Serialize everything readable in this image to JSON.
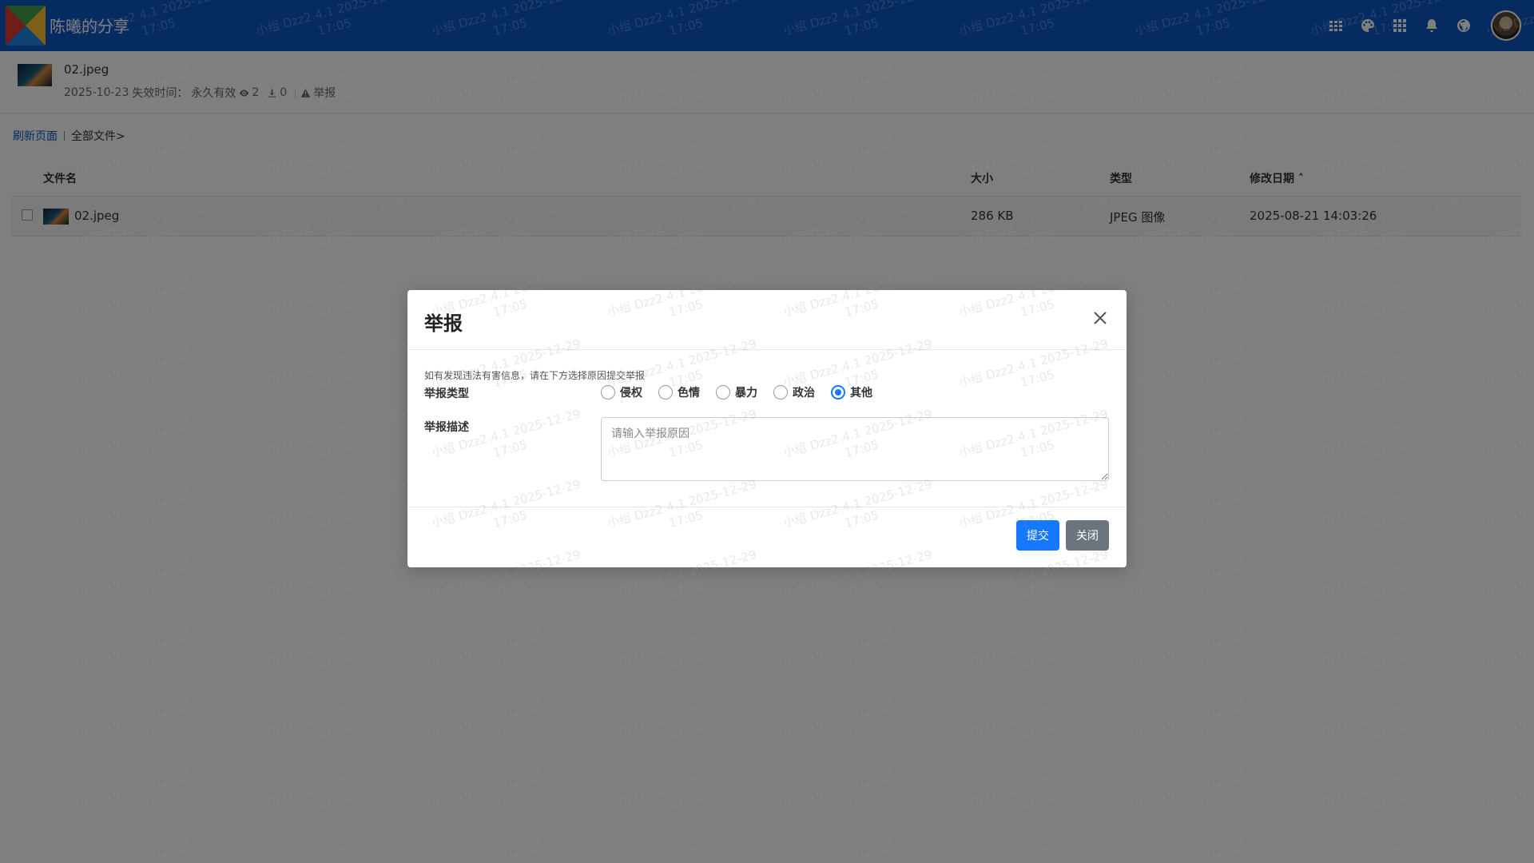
{
  "header": {
    "site_title": "陈曦的分享",
    "icons": [
      "grid-icon",
      "palette-icon",
      "apps-icon",
      "bell-icon",
      "globe-icon"
    ],
    "accent_color": "#0a56c2"
  },
  "file": {
    "name": "02.jpeg",
    "date": "2025-10-23",
    "expire_label": "失效时间：",
    "expire_value": "永久有效",
    "views": "2",
    "downloads": "0",
    "report_label": "举报"
  },
  "breadcrumb": {
    "refresh": "刷新页面",
    "all_files": "全部文件>"
  },
  "table": {
    "headers": {
      "name": "文件名",
      "size": "大小",
      "type": "类型",
      "modified": "修改日期 ˄"
    },
    "rows": [
      {
        "name": "02.jpeg",
        "size": "286 KB",
        "type": "JPEG 图像",
        "modified": "2025-08-21 14:03:26"
      }
    ]
  },
  "watermark": {
    "line1": "小组 Dzz2.4.1 2025-12-29",
    "line2": "17:05"
  },
  "modal": {
    "title": "举报",
    "tip": "如有发现违法有害信息，请在下方选择原因提交举报",
    "type_label": "举报类型",
    "options": [
      "侵权",
      "色情",
      "暴力",
      "政治",
      "其他"
    ],
    "selected": "其他",
    "desc_label": "举报描述",
    "desc_placeholder": "请输入举报原因",
    "submit_label": "提交",
    "close_label": "关闭",
    "primary_color": "#1677ff"
  }
}
